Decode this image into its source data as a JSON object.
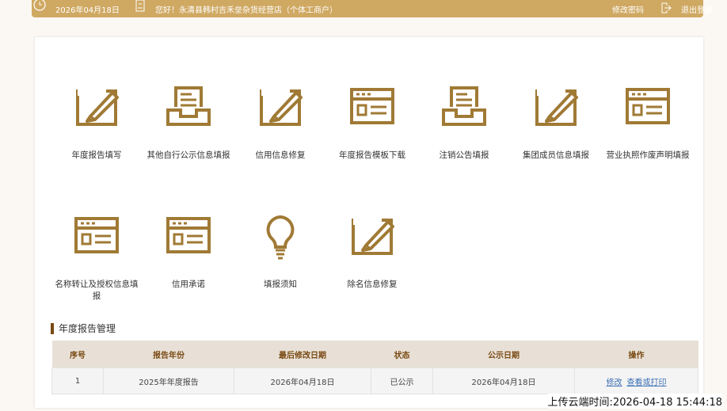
{
  "topbar": {
    "date": "2026年04月18日",
    "greeting": "您好！永清县韩村吉禾垒杂货经营店（个体工商户）",
    "change_password": "修改密码",
    "logout": "退出登录",
    "color": "#cfa862"
  },
  "tiles": [
    {
      "label": "年度报告填写",
      "icon": "edit-icon"
    },
    {
      "label": "其他自行公示信息填报",
      "icon": "tray-icon"
    },
    {
      "label": "信用信息修复",
      "icon": "edit-icon"
    },
    {
      "label": "年度报告模板下载",
      "icon": "form-icon"
    },
    {
      "label": "注销公告填报",
      "icon": "tray-icon"
    },
    {
      "label": "集团成员信息填报",
      "icon": "edit-icon"
    },
    {
      "label": "营业执照作废声明填报",
      "icon": "form-icon"
    },
    {
      "label": "名称转让及授权信息填报",
      "icon": "form-icon"
    },
    {
      "label": "信用承诺",
      "icon": "form-icon"
    },
    {
      "label": "填报须知",
      "icon": "bulb-icon"
    },
    {
      "label": "除名信息修复",
      "icon": "edit-icon"
    }
  ],
  "section": {
    "title": "年度报告管理"
  },
  "table": {
    "headers": [
      "序号",
      "报告年份",
      "最后修改日期",
      "状态",
      "公示日期",
      "操作"
    ],
    "rows": [
      {
        "no": "1",
        "year": "2025年年度报告",
        "modified": "2026年04月18日",
        "status": "已公示",
        "public_date": "2026年04月18日",
        "actions": [
          "修改",
          "查看或打印"
        ]
      }
    ]
  },
  "upload_time": "上传云端时间:2026-04-18 15:44:18",
  "accent": "#a07a35"
}
